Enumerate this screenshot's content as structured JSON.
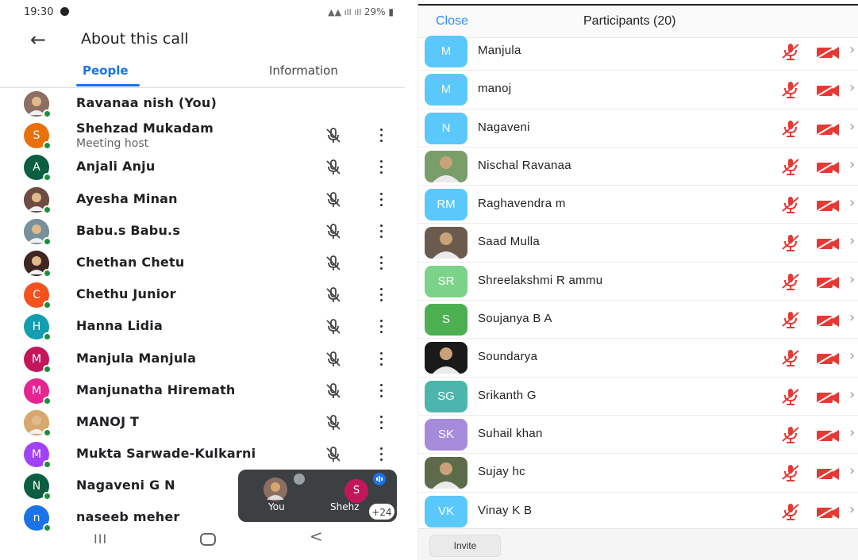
{
  "left": {
    "status_bar": {
      "time": "19:30",
      "signal_text": "29%"
    },
    "app_bar": {
      "title": "About this call",
      "back_icon": "arrow-left-icon"
    },
    "tabs": [
      {
        "label": "People",
        "selected": true
      },
      {
        "label": "Information",
        "selected": false
      }
    ],
    "people": [
      {
        "name": "Ravanaa nish (You)",
        "subtitle": "",
        "avatar_letter": "",
        "avatar_color": "#8d6e63",
        "photo": true,
        "controls": false
      },
      {
        "name": "Shehzad Mukadam",
        "subtitle": "Meeting host",
        "avatar_letter": "S",
        "avatar_color": "#e8710a",
        "photo": false,
        "controls": true
      },
      {
        "name": "Anjali Anju",
        "subtitle": "",
        "avatar_letter": "A",
        "avatar_color": "#0b5e3f",
        "photo": false,
        "controls": true
      },
      {
        "name": "Ayesha Minan",
        "subtitle": "",
        "avatar_letter": "",
        "avatar_color": "#6d4c41",
        "photo": true,
        "controls": true
      },
      {
        "name": "Babu.s Babu.s",
        "subtitle": "",
        "avatar_letter": "",
        "avatar_color": "#78909c",
        "photo": true,
        "controls": true
      },
      {
        "name": "Chethan Chetu",
        "subtitle": "",
        "avatar_letter": "",
        "avatar_color": "#3e2723",
        "photo": true,
        "controls": true
      },
      {
        "name": "Chethu Junior",
        "subtitle": "",
        "avatar_letter": "C",
        "avatar_color": "#f4511e",
        "photo": false,
        "controls": true
      },
      {
        "name": "Hanna Lidia",
        "subtitle": "",
        "avatar_letter": "H",
        "avatar_color": "#129eaf",
        "photo": false,
        "controls": true
      },
      {
        "name": "Manjula Manjula",
        "subtitle": "",
        "avatar_letter": "M",
        "avatar_color": "#c2185b",
        "photo": false,
        "controls": true
      },
      {
        "name": "Manjunatha Hiremath",
        "subtitle": "",
        "avatar_letter": "M",
        "avatar_color": "#e52592",
        "photo": false,
        "controls": true
      },
      {
        "name": "MANOJ T",
        "subtitle": "",
        "avatar_letter": "",
        "avatar_color": "#d7a86e",
        "photo": true,
        "controls": true
      },
      {
        "name": "Mukta Sarwade-Kulkarni",
        "subtitle": "",
        "avatar_letter": "M",
        "avatar_color": "#a142f4",
        "photo": false,
        "controls": true
      },
      {
        "name": "Nagaveni G N",
        "subtitle": "",
        "avatar_letter": "N",
        "avatar_color": "#0b5e3f",
        "photo": false,
        "controls": false
      },
      {
        "name": "naseeb meher",
        "subtitle": "",
        "avatar_letter": "n",
        "avatar_color": "#1a73e8",
        "photo": false,
        "controls": false
      }
    ],
    "floating_tile": {
      "you_label": "You",
      "other_label": "Shehz",
      "other_letter": "S",
      "more_count": "+24"
    },
    "nav_bar": {
      "recent": "III",
      "back": "<"
    }
  },
  "right": {
    "header": {
      "close_label": "Close",
      "title": "Participants (20)"
    },
    "participants": [
      {
        "name": "Manjula",
        "initials": "M",
        "avatar_color": "#5ac8fa",
        "photo": false
      },
      {
        "name": "manoj",
        "initials": "M",
        "avatar_color": "#5ac8fa",
        "photo": false
      },
      {
        "name": "Nagaveni",
        "initials": "N",
        "avatar_color": "#5ac8fa",
        "photo": false
      },
      {
        "name": "Nischal Ravanaa",
        "initials": "",
        "avatar_color": "#7a9e6a",
        "photo": true
      },
      {
        "name": "Raghavendra m",
        "initials": "RM",
        "avatar_color": "#5ac8fa",
        "photo": false
      },
      {
        "name": "Saad Mulla",
        "initials": "",
        "avatar_color": "#6b5b4e",
        "photo": true
      },
      {
        "name": "Shreelakshmi R ammu",
        "initials": "SR",
        "avatar_color": "#7bd389",
        "photo": false
      },
      {
        "name": "Soujanya B A",
        "initials": "S",
        "avatar_color": "#4caf50",
        "photo": false
      },
      {
        "name": "Soundarya",
        "initials": "",
        "avatar_color": "#1a1a1a",
        "photo": true
      },
      {
        "name": "Srikanth G",
        "initials": "SG",
        "avatar_color": "#4db6ac",
        "photo": false
      },
      {
        "name": "Suhail khan",
        "initials": "SK",
        "avatar_color": "#a78bdb",
        "photo": false
      },
      {
        "name": "Sujay hc",
        "initials": "",
        "avatar_color": "#5d6b4a",
        "photo": true
      },
      {
        "name": "Vinay K B",
        "initials": "VK",
        "avatar_color": "#5ac8fa",
        "photo": false
      }
    ],
    "footer": {
      "invite_label": "Invite"
    },
    "colors": {
      "muted_red": "#e53935",
      "accent_blue": "#2d8cff"
    }
  }
}
